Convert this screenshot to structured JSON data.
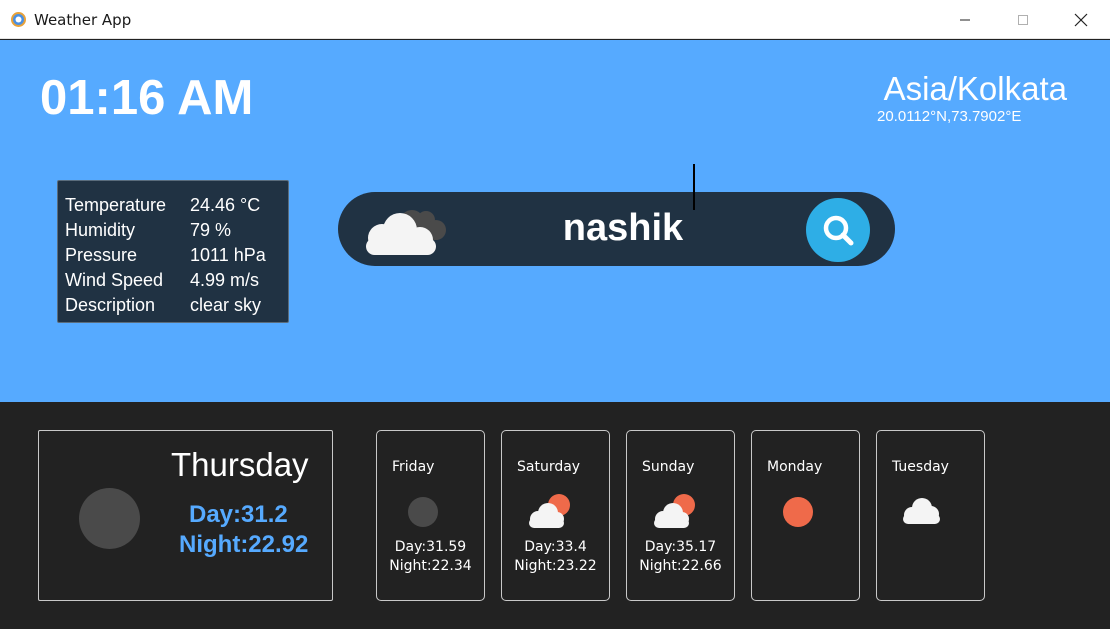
{
  "window": {
    "title": "Weather App"
  },
  "header": {
    "clock": "01:16 AM",
    "timezone": "Asia/Kolkata",
    "coordinates": "20.0112°N,73.7902°E"
  },
  "info": {
    "rows": [
      {
        "label": "Temperature",
        "value": "24.46 °C"
      },
      {
        "label": "Humidity",
        "value": "79 %"
      },
      {
        "label": "Pressure",
        "value": "1011 hPa"
      },
      {
        "label": "Wind Speed",
        "value": "4.99 m/s"
      },
      {
        "label": "Description",
        "value": "clear sky"
      }
    ]
  },
  "search": {
    "value": "nashik",
    "icon": "search-icon"
  },
  "today": {
    "day": "Thursday",
    "day_temp": "Day:31.2",
    "night_temp": "Night:22.92",
    "icon": "moon-icon"
  },
  "forecast": [
    {
      "day": "Friday",
      "day_temp": "Day:31.59",
      "night_temp": "Night:22.34",
      "icon": "moon-icon"
    },
    {
      "day": "Saturday",
      "day_temp": "Day:33.4",
      "night_temp": "Night:23.22",
      "icon": "partly-cloudy-icon"
    },
    {
      "day": "Sunday",
      "day_temp": "Day:35.17",
      "night_temp": "Night:22.66",
      "icon": "partly-cloudy-icon"
    },
    {
      "day": "Monday",
      "day_temp": "",
      "night_temp": "",
      "icon": "sun-icon"
    },
    {
      "day": "Tuesday",
      "day_temp": "",
      "night_temp": "",
      "icon": "cloud-icon"
    }
  ],
  "colors": {
    "sky": "#56aaff",
    "panel": "#203243",
    "dark": "#222222",
    "accent": "#2eaee6",
    "sun": "#ef6a4a"
  }
}
